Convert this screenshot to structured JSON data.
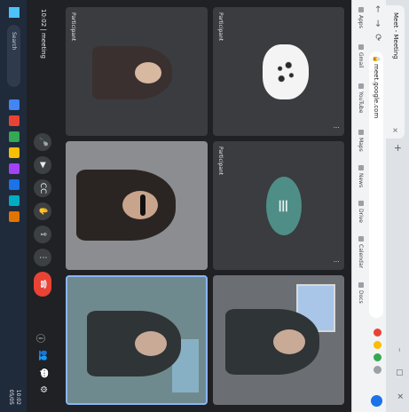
{
  "browser": {
    "tab_title": "Meet - Meeting",
    "tab_close": "×",
    "new_tab": "+",
    "window_controls": "– ▢ ✕",
    "nav_back": "←",
    "nav_forward": "→",
    "nav_reload": "⟳",
    "lock_icon": "🔒",
    "url": "meet.google.com",
    "bookmarks": [
      "Apps",
      "Gmail",
      "YouTube",
      "Maps",
      "News",
      "Drive",
      "Calendar",
      "Docs"
    ],
    "extension_colors": [
      "#ea4335",
      "#fbbc04",
      "#34a853",
      "#9aa0a6"
    ]
  },
  "meeting": {
    "tiles": [
      {
        "id": "t1",
        "name": "Participant",
        "pin": "⋮"
      },
      {
        "id": "t2",
        "name": "Participant",
        "pin": "⋮"
      },
      {
        "id": "t3",
        "name": "",
        "pin": ""
      },
      {
        "id": "t4",
        "name": "Participant",
        "pin": ""
      },
      {
        "id": "t5",
        "name": "",
        "pin": ""
      },
      {
        "id": "t6",
        "name": "",
        "pin": ""
      }
    ]
  },
  "controls": {
    "meeting_info": "10:02 | meeting",
    "mic": "🎤",
    "camera": "▶",
    "captions": "CC",
    "raise_hand": "✋",
    "present": "⇪",
    "more": "⋮",
    "hangup": "☎",
    "info": "ⓘ",
    "people": "👥",
    "chat": "💬",
    "activities": "⚙"
  },
  "taskbar": {
    "search_placeholder": "Search",
    "app_colors": [
      "#4285f4",
      "#ea4335",
      "#34a853",
      "#fbbc04",
      "#a142f4",
      "#1a73e8",
      "#00acc1",
      "#e37400"
    ],
    "clock_time": "10:02",
    "clock_date": "05/05"
  }
}
